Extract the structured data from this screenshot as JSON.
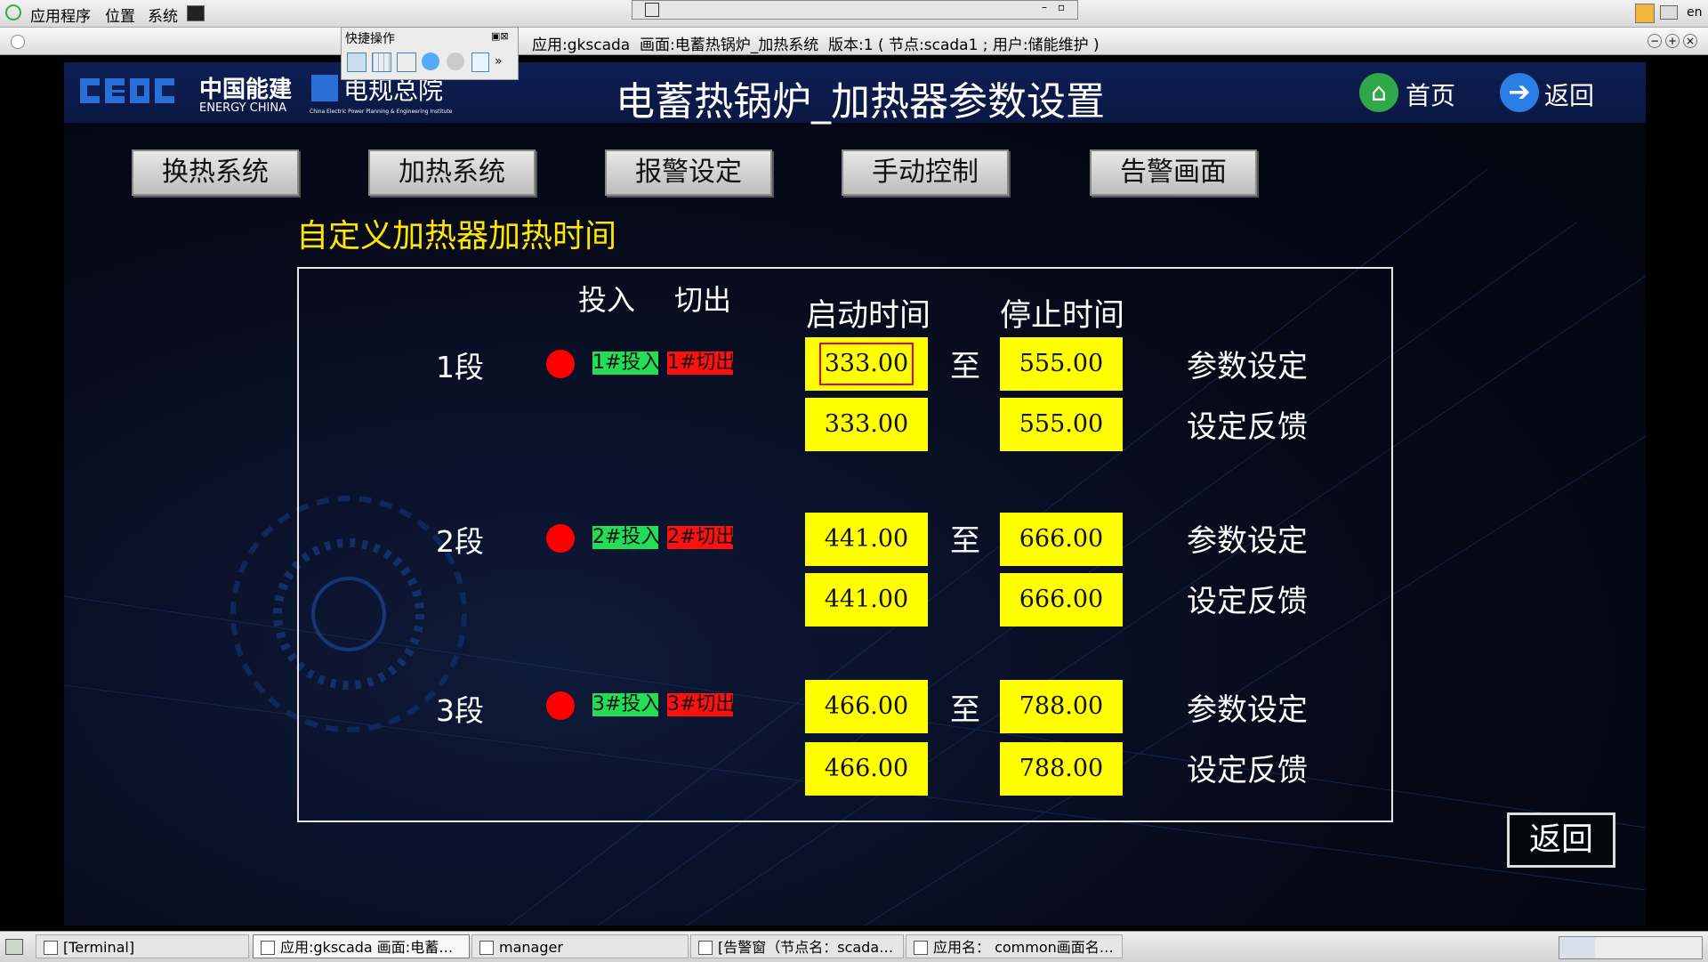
{
  "system_bar": {
    "menu_apps": "应用程序",
    "menu_places": "位置",
    "menu_system": "系统",
    "lang": "en"
  },
  "quickbar": {
    "title": "快捷操作"
  },
  "window_title": "应用:gkscada  画面:电蓄热锅炉_加热系统  版本:1 ( 节点:scada1 ; 用户:储能维护 )",
  "header": {
    "logo_cn": "中国能建",
    "logo_en": "ENERGY CHINA",
    "logo2_cn": "电规总院",
    "logo2_en": "China Electric Power Planning & Engineering Institute",
    "title": "电蓄热锅炉_加热器参数设置",
    "home_label": "首页",
    "back_label": "返回"
  },
  "nav": [
    "换热系统",
    "加热系统",
    "报警设定",
    "手动控制",
    "告警画面"
  ],
  "section_title": "自定义加热器加热时间",
  "table_headers": {
    "in": "投入",
    "out": "切出",
    "start": "启动时间",
    "stop": "停止时间"
  },
  "segments": [
    {
      "label": "1段",
      "in_btn": "1#投入",
      "out_btn": "1#切出",
      "set_start": "333.00",
      "set_stop": "555.00",
      "fb_start": "333.00",
      "fb_stop": "555.00"
    },
    {
      "label": "2段",
      "in_btn": "2#投入",
      "out_btn": "2#切出",
      "set_start": "441.00",
      "set_stop": "666.00",
      "fb_start": "441.00",
      "fb_stop": "666.00"
    },
    {
      "label": "3段",
      "in_btn": "3#投入",
      "out_btn": "3#切出",
      "set_start": "466.00",
      "set_stop": "788.00",
      "fb_start": "466.00",
      "fb_stop": "788.00"
    }
  ],
  "to_label": "至",
  "param_set_label": "参数设定",
  "feedback_label": "设定反馈",
  "return_button": "返回",
  "taskbar": [
    "[Terminal]",
    "应用:gkscada  画面:电蓄…",
    "manager",
    "[告警窗（节点名：scada…",
    "应用名： common画面名…"
  ],
  "colors": {
    "value_box": "#ffff00",
    "in_button": "#22dd55",
    "out_button": "#ff1010",
    "indicator": "#ff0000",
    "section_title": "#ffe600"
  }
}
